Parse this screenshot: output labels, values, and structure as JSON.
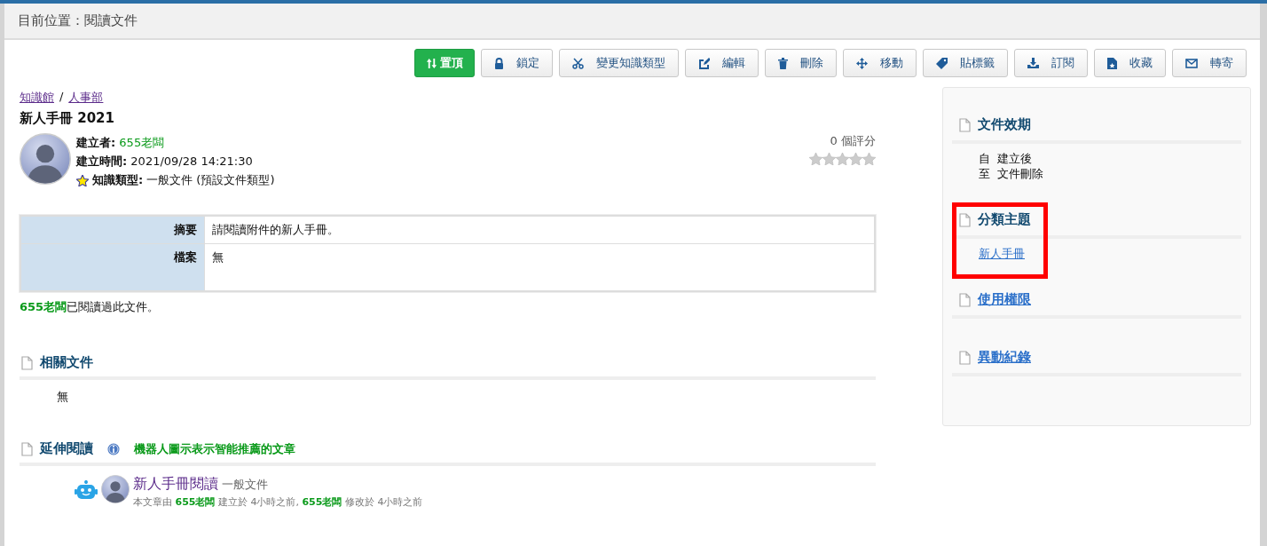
{
  "location_bar": {
    "text": "目前位置：閱讀文件"
  },
  "toolbar": [
    {
      "label": "置頂",
      "kind": "primary"
    },
    {
      "label": "鎖定",
      "kind": "default"
    },
    {
      "label": "變更知識類型",
      "kind": "default"
    },
    {
      "label": "編輯",
      "kind": "default"
    },
    {
      "label": "刪除",
      "kind": "default"
    },
    {
      "label": "移動",
      "kind": "default"
    },
    {
      "label": "貼標籤",
      "kind": "default"
    },
    {
      "label": "訂閱",
      "kind": "default"
    },
    {
      "label": "收藏",
      "kind": "default"
    },
    {
      "label": "轉寄",
      "kind": "default"
    }
  ],
  "breadcrumb": {
    "items": [
      "知識館",
      "人事部"
    ],
    "separator": "/"
  },
  "document": {
    "title": "新人手冊 2021",
    "creator_label": "建立者:",
    "creator": "655老闆",
    "created_label": "建立時間:",
    "created": "2021/09/28 14:21:30",
    "type_label": "知識類型:",
    "type": "一般文件 (預設文件類型)",
    "rating": {
      "count": "0 個評分",
      "stars": 0
    }
  },
  "fields": [
    {
      "label": "摘要",
      "value": "請閱讀附件的新人手冊。"
    },
    {
      "label": "檔案",
      "value": "無"
    }
  ],
  "read_note": "**655老闆**已閱讀過此文件。",
  "related": {
    "title": "相關文件",
    "body": "無"
  },
  "extended": {
    "title": "延伸閱讀",
    "note": "機器人圖示表示智能推薦的文章",
    "items": [
      {
        "title": "新人手冊閱讀",
        "type": "一般文件",
        "meta": "本文章由 **655老闆** 建立於 4小時之前, **655老闆** 修改於 4小時之前"
      }
    ]
  },
  "sidebar": {
    "sections": [
      {
        "title": "文件效期",
        "link": false,
        "highlighted": false,
        "lines": [
          "自  建立後",
          "至  文件刪除"
        ]
      },
      {
        "title": "分類主題",
        "link": false,
        "highlighted": true,
        "links": [
          "新人手冊"
        ]
      },
      {
        "title": "使用權限",
        "link": true,
        "highlighted": false
      },
      {
        "title": "異動紀錄",
        "link": true,
        "highlighted": false
      }
    ]
  }
}
